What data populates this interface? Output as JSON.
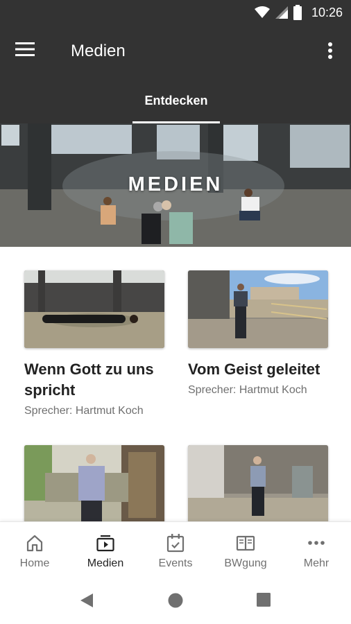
{
  "status_bar": {
    "time": "10:26",
    "icons": [
      "wifi-icon",
      "signal-icon",
      "battery-icon"
    ]
  },
  "app_bar": {
    "title": "Medien",
    "menu_icon": "hamburger-menu-icon",
    "more_icon": "more-vert-icon"
  },
  "tabs": [
    {
      "label": "Entdecken",
      "active": true
    }
  ],
  "hero": {
    "title": "MEDIEN"
  },
  "cards": [
    {
      "title": "Wenn Gott zu uns spricht",
      "subtitle": "Sprecher: Hartmut Koch"
    },
    {
      "title": "Vom Geist geleitet",
      "subtitle": "Sprecher: Hartmut Koch"
    },
    {
      "title": "",
      "subtitle": ""
    },
    {
      "title": "",
      "subtitle": ""
    }
  ],
  "bottom_nav": [
    {
      "label": "Home",
      "icon": "home-icon",
      "active": false
    },
    {
      "label": "Medien",
      "icon": "media-player-icon",
      "active": true
    },
    {
      "label": "Events",
      "icon": "calendar-icon",
      "active": false
    },
    {
      "label": "BWgung",
      "icon": "book-icon",
      "active": false
    },
    {
      "label": "Mehr",
      "icon": "more-horiz-icon",
      "active": false
    }
  ],
  "colors": {
    "app_bar": "#333333",
    "active_text": "#222222",
    "inactive_text": "#707070"
  }
}
